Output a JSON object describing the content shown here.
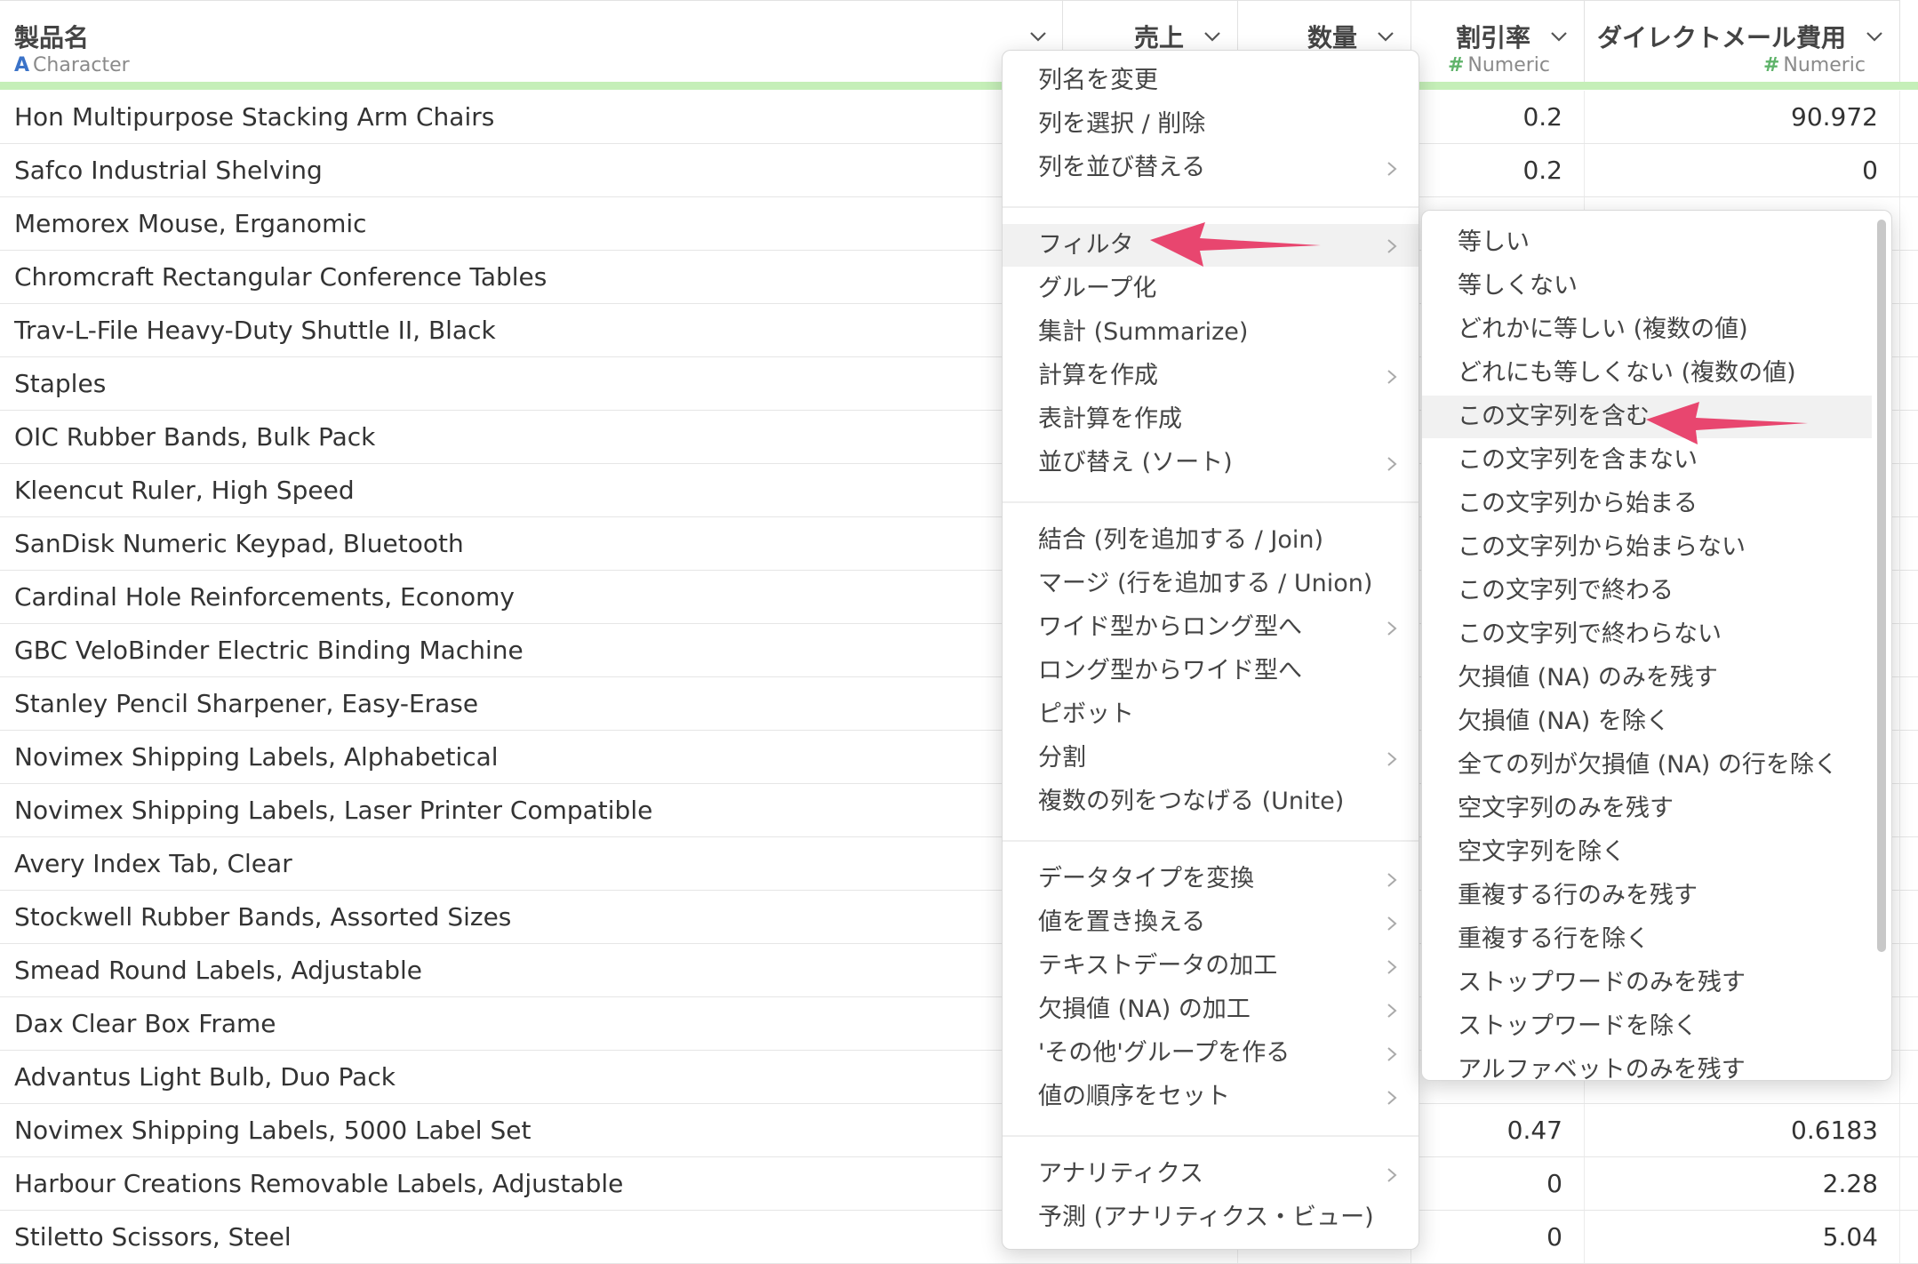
{
  "columns": [
    {
      "name": "製品名",
      "type_icon": "A",
      "type_label": "Character"
    },
    {
      "name": "売上"
    },
    {
      "name": "数量"
    },
    {
      "name": "割引率",
      "type_icon": "#",
      "type_label": "Numeric"
    },
    {
      "name": "ダイレクトメール費用",
      "type_icon": "#",
      "type_label": "Numeric"
    }
  ],
  "rows": [
    {
      "name": "Hon Multipurpose Stacking Arm Chairs",
      "discount": "0.2",
      "dm_cost": "90.972"
    },
    {
      "name": "Safco Industrial Shelving",
      "discount": "0.2",
      "dm_cost": "0"
    },
    {
      "name": "Memorex Mouse, Erganomic",
      "discount": "",
      "dm_cost": ""
    },
    {
      "name": "Chromcraft Rectangular Conference Tables",
      "discount": "",
      "dm_cost": ""
    },
    {
      "name": "Trav-L-File Heavy-Duty Shuttle II, Black",
      "discount": "",
      "dm_cost": ""
    },
    {
      "name": "Staples",
      "discount": "",
      "dm_cost": ""
    },
    {
      "name": "OIC Rubber Bands, Bulk Pack",
      "discount": "",
      "dm_cost": ""
    },
    {
      "name": "Kleencut Ruler, High Speed",
      "discount": "",
      "dm_cost": ""
    },
    {
      "name": "SanDisk Numeric Keypad, Bluetooth",
      "discount": "",
      "dm_cost": ""
    },
    {
      "name": "Cardinal Hole Reinforcements, Economy",
      "discount": "",
      "dm_cost": ""
    },
    {
      "name": "GBC VeloBinder Electric Binding Machine",
      "discount": "",
      "dm_cost": ""
    },
    {
      "name": "Stanley Pencil Sharpener, Easy-Erase",
      "discount": "",
      "dm_cost": ""
    },
    {
      "name": "Novimex Shipping Labels, Alphabetical",
      "discount": "",
      "dm_cost": ""
    },
    {
      "name": "Novimex Shipping Labels, Laser Printer Compatible",
      "discount": "",
      "dm_cost": ""
    },
    {
      "name": "Avery Index Tab, Clear",
      "discount": "",
      "dm_cost": ""
    },
    {
      "name": "Stockwell Rubber Bands, Assorted Sizes",
      "discount": "",
      "dm_cost": ""
    },
    {
      "name": "Smead Round Labels, Adjustable",
      "discount": "",
      "dm_cost": ""
    },
    {
      "name": "Dax Clear Box Frame",
      "discount": "",
      "dm_cost": ""
    },
    {
      "name": "Advantus Light Bulb, Duo Pack",
      "discount": "",
      "dm_cost": ""
    },
    {
      "name": "Novimex Shipping Labels, 5000 Label Set",
      "discount": "0.47",
      "dm_cost": "0.6183"
    },
    {
      "name": "Harbour Creations Removable Labels, Adjustable",
      "discount": "0",
      "dm_cost": "2.28"
    },
    {
      "name": "Stiletto Scissors, Steel",
      "discount": "0",
      "dm_cost": "5.04"
    }
  ],
  "context_menu": {
    "items": [
      {
        "label": "列名を変更",
        "submenu": false
      },
      {
        "label": "列を選択 / 削除",
        "submenu": false
      },
      {
        "label": "列を並び替える",
        "submenu": true
      },
      {
        "separator": true
      },
      {
        "label": "フィルタ",
        "submenu": true,
        "highlighted": true
      },
      {
        "label": "グループ化",
        "submenu": false
      },
      {
        "label": "集計 (Summarize)",
        "submenu": false
      },
      {
        "label": "計算を作成",
        "submenu": true
      },
      {
        "label": "表計算を作成",
        "submenu": false
      },
      {
        "label": "並び替え (ソート)",
        "submenu": true
      },
      {
        "separator": true
      },
      {
        "label": "結合 (列を追加する / Join)",
        "submenu": false
      },
      {
        "label": "マージ (行を追加する / Union)",
        "submenu": false
      },
      {
        "label": "ワイド型からロング型へ",
        "submenu": true
      },
      {
        "label": "ロング型からワイド型へ",
        "submenu": false
      },
      {
        "label": "ピボット",
        "submenu": false
      },
      {
        "label": "分割",
        "submenu": true
      },
      {
        "label": "複数の列をつなげる (Unite)",
        "submenu": false
      },
      {
        "separator": true
      },
      {
        "label": "データタイプを変換",
        "submenu": true
      },
      {
        "label": "値を置き換える",
        "submenu": true
      },
      {
        "label": "テキストデータの加工",
        "submenu": true
      },
      {
        "label": "欠損値 (NA) の加工",
        "submenu": true
      },
      {
        "label": "'その他'グループを作る",
        "submenu": true
      },
      {
        "label": "値の順序をセット",
        "submenu": true
      },
      {
        "separator": true
      },
      {
        "label": "アナリティクス",
        "submenu": true
      },
      {
        "label": "予測 (アナリティクス・ビュー)",
        "submenu": false
      }
    ]
  },
  "filter_submenu": {
    "items": [
      {
        "label": "等しい"
      },
      {
        "label": "等しくない"
      },
      {
        "label": "どれかに等しい (複数の値)"
      },
      {
        "label": "どれにも等しくない (複数の値)"
      },
      {
        "label": "この文字列を含む",
        "highlighted": true
      },
      {
        "label": "この文字列を含まない"
      },
      {
        "label": "この文字列から始まる"
      },
      {
        "label": "この文字列から始まらない"
      },
      {
        "label": "この文字列で終わる"
      },
      {
        "label": "この文字列で終わらない"
      },
      {
        "label": "欠損値 (NA) のみを残す"
      },
      {
        "label": "欠損値 (NA) を除く"
      },
      {
        "label": "全ての列が欠損値 (NA) の行を除く"
      },
      {
        "label": "空文字列のみを残す"
      },
      {
        "label": "空文字列を除く"
      },
      {
        "label": "重複する行のみを残す"
      },
      {
        "label": "重複する行を除く"
      },
      {
        "label": "ストップワードのみを残す"
      },
      {
        "label": "ストップワードを除く"
      },
      {
        "label": "アルファベットのみを残す"
      }
    ]
  },
  "colors": {
    "accent": "#e8466f",
    "type_character": "#3b73c8",
    "type_numeric": "#5fb36a",
    "green_bar": "#c5efb8"
  },
  "icons": {
    "dropdown": "chevron-down-icon",
    "submenu": "chevron-right-icon",
    "annotation": "arrow-left-icon"
  }
}
